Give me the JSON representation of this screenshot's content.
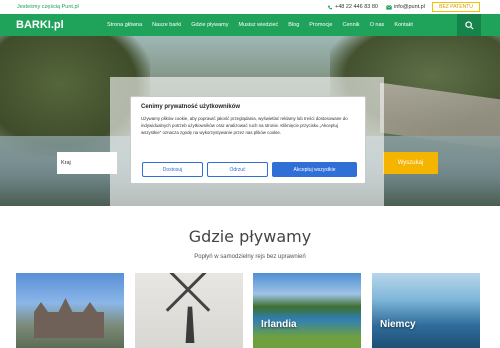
{
  "topbar": {
    "partner_text": "Jesteśmy częścią Punt.pl",
    "phone": "+48 22 446 83 80",
    "email": "info@punt.pl",
    "patent_button": "BEZ PATENTU"
  },
  "nav": {
    "logo": "BARKI.pl",
    "items": [
      "Strona główna",
      "Nasze barki",
      "Gdzie pływamy",
      "Musisz wiedzieć",
      "Blog",
      "Promocje",
      "Cennik",
      "O nas",
      "Kontakt"
    ]
  },
  "search": {
    "country_placeholder": "Kraj",
    "button": "Wyszukaj"
  },
  "cookie": {
    "title": "Cenimy prywatność użytkowników",
    "body": "Używamy plików cookie, aby poprawić jakość przeglądania, wyświetlać reklamy lub treści dostosowane do indywidualnych potrzeb użytkowników oraz analizować ruch na stronie. Kliknięcie przycisku „Akceptuj wszystkie” oznacza zgodę na wykorzystywanie przez nas plików cookie.",
    "customize": "Dostosuj",
    "reject": "Odrzuć",
    "accept": "Akceptuj wszystkie"
  },
  "section": {
    "title": "Gdzie pływamy",
    "subtitle": "Popłyń w samodzielny rejs bez uprawnień"
  },
  "cards": [
    {
      "label": ""
    },
    {
      "label": ""
    },
    {
      "label": "Irlandia"
    },
    {
      "label": "Niemcy"
    }
  ],
  "colors": {
    "brand_green": "#1fa35a",
    "accent_yellow": "#f4b400",
    "cookie_blue": "#2f6fd6"
  }
}
